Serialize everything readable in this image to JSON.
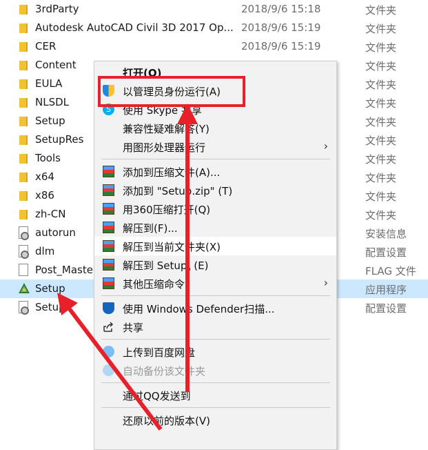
{
  "files": [
    {
      "name": "3rdParty",
      "date": "2018/9/6 15:18",
      "type": "文件夹",
      "icon": "folder-icon"
    },
    {
      "name": "Autodesk AutoCAD Civil 3D 2017 Op...",
      "date": "2018/9/6 15:19",
      "type": "文件夹",
      "icon": "folder-icon"
    },
    {
      "name": "CER",
      "date": "2018/9/6 15:19",
      "type": "文件夹",
      "icon": "folder-icon"
    },
    {
      "name": "Content",
      "date": "2018/9/6 15:19",
      "type": "文件夹",
      "icon": "folder-icon"
    },
    {
      "name": "EULA",
      "date": "",
      "type": "文件夹",
      "icon": "folder-icon"
    },
    {
      "name": "NLSDL",
      "date": "",
      "type": "文件夹",
      "icon": "folder-icon"
    },
    {
      "name": "Setup",
      "date": "",
      "type": "文件夹",
      "icon": "folder-icon"
    },
    {
      "name": "SetupRes",
      "date": "",
      "type": "文件夹",
      "icon": "folder-icon"
    },
    {
      "name": "Tools",
      "date": "",
      "type": "文件夹",
      "icon": "folder-icon"
    },
    {
      "name": "x64",
      "date": "",
      "type": "文件夹",
      "icon": "folder-icon"
    },
    {
      "name": "x86",
      "date": "",
      "type": "文件夹",
      "icon": "folder-icon"
    },
    {
      "name": "zh-CN",
      "date": "",
      "type": "文件夹",
      "icon": "folder-icon"
    },
    {
      "name": "autorun",
      "date": "",
      "type": "安装信息",
      "icon": "settings-file-icon"
    },
    {
      "name": "dlm",
      "date": "",
      "type": "配置设置",
      "icon": "settings-file-icon"
    },
    {
      "name": "Post_Maste",
      "date": "",
      "type": "FLAG 文件",
      "icon": "file-icon"
    },
    {
      "name": "Setup",
      "date": "",
      "type": "应用程序",
      "icon": "setup-app-icon",
      "selected": true
    },
    {
      "name": "Setup",
      "date": "",
      "type": "配置设置",
      "icon": "settings-file-icon"
    }
  ],
  "menu": [
    {
      "label": "打开(O)",
      "bold": true
    },
    {
      "label": "以管理员身份运行(A)",
      "icon": "shield-icon"
    },
    {
      "label": "使用 Skype 共享",
      "icon": "skype-icon"
    },
    {
      "label": "兼容性疑难解答(Y)"
    },
    {
      "label": "用图形处理器运行",
      "submenu": true
    },
    {
      "sep": true
    },
    {
      "label": "添加到压缩文件(A)...",
      "icon": "archive-icon"
    },
    {
      "label": "添加到 \"Setup.zip\" (T)",
      "icon": "archive-icon"
    },
    {
      "label": "用360压缩打开(Q)",
      "icon": "archive-icon"
    },
    {
      "label": "解压到(F)...",
      "icon": "archive-icon"
    },
    {
      "label": "解压到当前文件夹(X)",
      "icon": "archive-icon",
      "hover": true
    },
    {
      "label": "解压到 Setup\\ (E)",
      "icon": "archive-icon"
    },
    {
      "label": "其他压缩命令",
      "icon": "archive-icon",
      "submenu": true
    },
    {
      "sep": true
    },
    {
      "label": "使用 Windows Defender扫描...",
      "icon": "defender-icon"
    },
    {
      "label": "共享",
      "icon": "share-icon"
    },
    {
      "sep": true
    },
    {
      "label": "上传到百度网盘",
      "icon": "cloud-icon"
    },
    {
      "label": "自动备份该文件夹",
      "icon": "cloud-icon",
      "disabled": true
    },
    {
      "sep": true
    },
    {
      "label": "通过QQ发送到"
    },
    {
      "sep": true
    },
    {
      "label": "还原以前的版本(V)"
    }
  ],
  "colors": {
    "annotation": "#e8202a",
    "selection": "#cce8ff"
  }
}
